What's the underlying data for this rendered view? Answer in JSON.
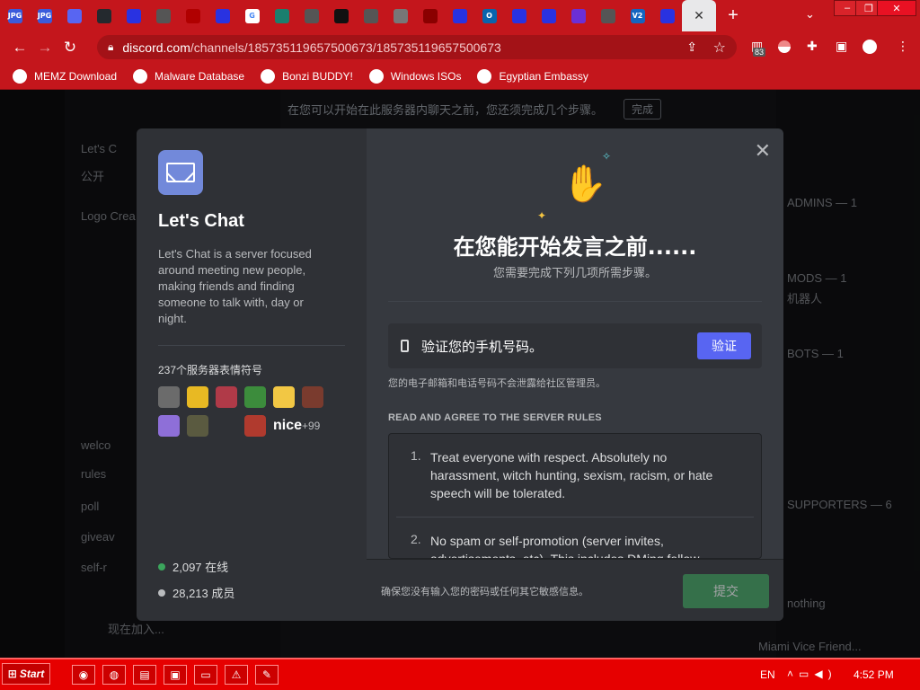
{
  "browser": {
    "tabs": [
      {
        "icon": "jpg-icon",
        "label": "JPG",
        "color": "#3b5bdb"
      },
      {
        "icon": "jpg-icon",
        "label": "JPG",
        "color": "#3b5bdb"
      },
      {
        "icon": "discord-icon",
        "label": "",
        "color": "#5865f2"
      },
      {
        "icon": "github-icon",
        "label": "",
        "color": "#24292e"
      },
      {
        "icon": "baidu-icon",
        "label": "",
        "color": "#2932e1"
      },
      {
        "icon": "globe-icon",
        "label": "",
        "color": "#555555"
      },
      {
        "icon": "red-icon",
        "label": "",
        "color": "#b00000"
      },
      {
        "icon": "baidu-icon",
        "label": "",
        "color": "#2932e1"
      },
      {
        "icon": "google-icon",
        "label": "G",
        "color": "#ffffff"
      },
      {
        "icon": "teal-icon",
        "label": "",
        "color": "#1a7f6e"
      },
      {
        "icon": "globe-icon",
        "label": "",
        "color": "#555555"
      },
      {
        "icon": "roblox-icon",
        "label": "",
        "color": "#111111"
      },
      {
        "icon": "globe-icon",
        "label": "",
        "color": "#555555"
      },
      {
        "icon": "roblox-icon",
        "label": "",
        "color": "#777777"
      },
      {
        "icon": "red-icon",
        "label": "",
        "color": "#8a0000"
      },
      {
        "icon": "baidu-icon",
        "label": "",
        "color": "#2932e1"
      },
      {
        "icon": "outlook-icon",
        "label": "O",
        "color": "#0a64ad"
      },
      {
        "icon": "baidu-icon",
        "label": "",
        "color": "#2932e1"
      },
      {
        "icon": "baidu-icon",
        "label": "",
        "color": "#2932e1"
      },
      {
        "icon": "purple-icon",
        "label": "",
        "color": "#6b2fd6"
      },
      {
        "icon": "globe-icon",
        "label": "",
        "color": "#555555"
      },
      {
        "icon": "v2-icon",
        "label": "V2",
        "color": "#1565c0"
      },
      {
        "icon": "baidu-icon",
        "label": "",
        "color": "#2932e1"
      }
    ],
    "active_tab_close": "✕",
    "new_tab": "+",
    "tab_dropdown": "⌄",
    "url_host": "discord.com",
    "url_path": "/channels/185735119657500673/185735119657500673",
    "extension_badge": "83",
    "bookmarks": [
      {
        "label": "MEMZ Download",
        "icon": "globe-icon"
      },
      {
        "label": "Malware Database",
        "icon": "globe-icon"
      },
      {
        "label": "Bonzi BUDDY!",
        "icon": "bonzi-icon"
      },
      {
        "label": "Windows ISOs",
        "icon": "rainbow-icon"
      },
      {
        "label": "Egyptian Embassy",
        "icon": "wix-icon"
      }
    ]
  },
  "backdrop": {
    "notice": "在您可以开始在此服务器内聊天之前，您还须完成几个步骤。",
    "notice_button": "完成",
    "channel_items": [
      "Let's C",
      "公开",
      "Logo Crea",
      "welco",
      "rules",
      "poll",
      "giveav",
      "self-r"
    ],
    "member_items": [
      "ADMINS — 1",
      "MODS — 1",
      "机器人",
      "BOTS — 1",
      "SUPPORTERS — 6",
      "nothing",
      "Miami Vice Friend..."
    ],
    "user_status": "现在加入..."
  },
  "modal": {
    "server_name": "Let's Chat",
    "server_description": "Let's Chat is a server focused around meeting new people, making friends and finding someone to talk with, day or night.",
    "emoji_label": "237个服务器表情符号",
    "emoji_colors": [
      "#6b6b6b",
      "#e8b923",
      "#b03a48",
      "#3c8c3c",
      "#f2c744",
      "#7a3b2e",
      "#8e6fd8",
      "#5a5a40",
      "",
      "#b03a2e",
      "nice",
      "+99"
    ],
    "online_count": "2,097 在线",
    "member_count": "28,213 成员",
    "online_color": "#3ba55c",
    "member_color": "#b9bbbe",
    "headline": "在您能开始发言之前......",
    "subheadline": "您需要完成下列几项所需步骤。",
    "verify_text": "验证您的手机号码。",
    "verify_button": "验证",
    "verify_note": "您的电子邮箱和电话号码不会泄露给社区管理员。",
    "rules_title": "READ AND AGREE TO THE SERVER RULES",
    "rules": [
      {
        "num": "1.",
        "text": "Treat everyone with respect. Absolutely no harassment, witch hunting, sexism, racism, or hate speech will be tolerated."
      },
      {
        "num": "2.",
        "text": "No spam or self-promotion (server invites, advertisements, etc). This includes DMing fellow"
      }
    ],
    "footer_note": "确保您没有输入您的密码或任何其它敏感信息。",
    "submit_button": "提交",
    "accent_color": "#5865f2",
    "submit_color": "#3ba55c"
  },
  "taskbar": {
    "start_label": "Start",
    "apps": [
      "chrome-icon",
      "globe-icon",
      "folder-icon",
      "computer-icon",
      "window-icon",
      "warning-icon",
      "paint-icon"
    ],
    "language": "EN",
    "time": "4:52 PM"
  }
}
